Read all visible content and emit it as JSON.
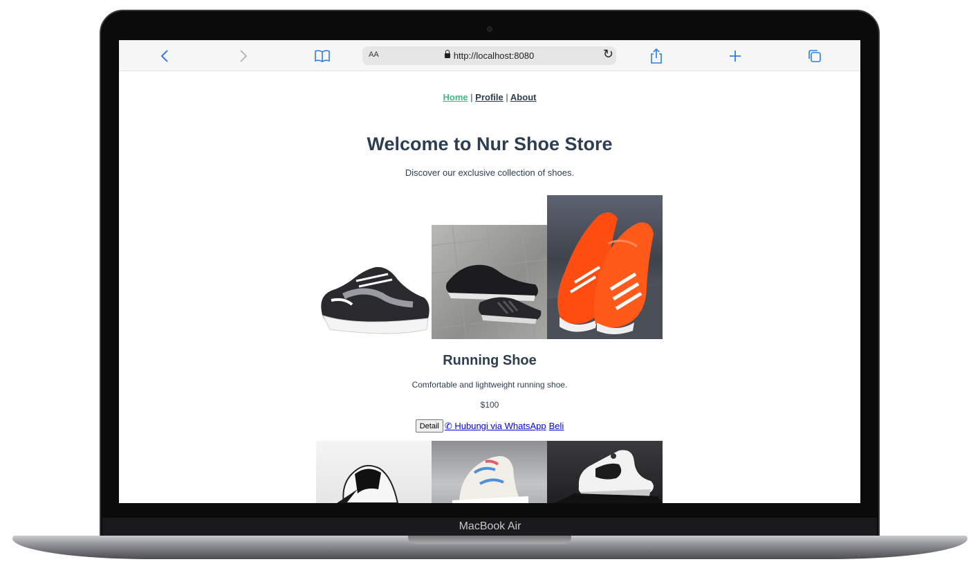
{
  "browser": {
    "address_aa": "AA",
    "url": "http://localhost:8080"
  },
  "device": {
    "model_label": "MacBook Air"
  },
  "nav": {
    "items": [
      "Home",
      "Profile",
      "About"
    ],
    "separator": "|"
  },
  "hero": {
    "title": "Welcome to Nur Shoe Store",
    "subtitle": "Discover our exclusive collection of shoes."
  },
  "product": {
    "name": "Running Shoe",
    "description": "Comfortable and lightweight running shoe.",
    "price": "$100",
    "detail_button": "Detail",
    "whatsapp_link": "Hubungi via WhatsApp",
    "buy_link": "Beli"
  },
  "colors": {
    "accent_green": "#42b983",
    "text_dark": "#2c3e50",
    "link_blue": "#0000ee",
    "safari_blue": "#2f7de1"
  }
}
